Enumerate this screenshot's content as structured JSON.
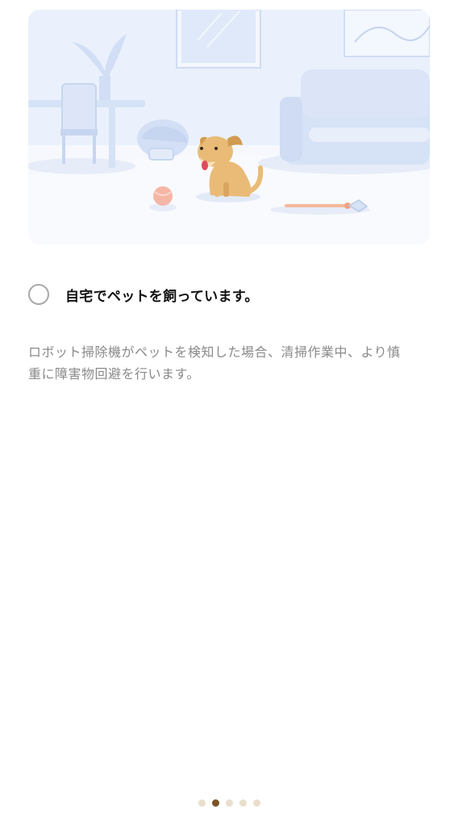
{
  "illustration": {
    "icon": "pet-room-illustration"
  },
  "option": {
    "label": "自宅でペットを飼っています。",
    "selected": false
  },
  "description": {
    "line1": "ロボット掃除機がペットを検知した場合、清掃作業中、より慎",
    "line2": "重に障害物回避を行います。"
  },
  "pager": {
    "total": 5,
    "active_index": 1
  },
  "colors": {
    "accent": "#7a5424",
    "dot_inactive": "#e9dfcc",
    "radio_border": "#a8a8a8",
    "text_primary": "#111111",
    "text_secondary": "#8a8a8a",
    "illustration_bg": "#eef3fc"
  }
}
